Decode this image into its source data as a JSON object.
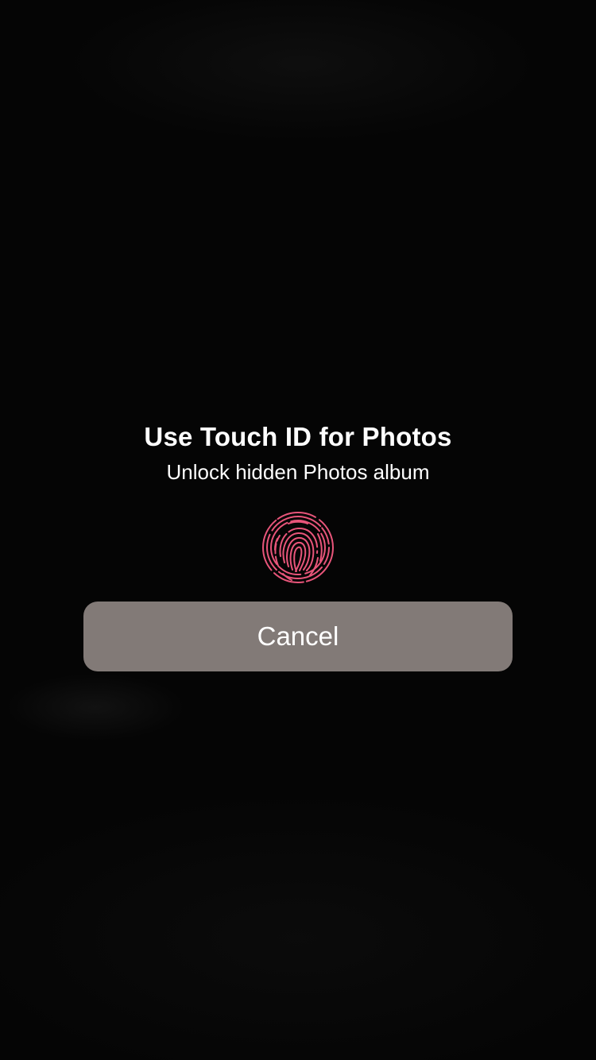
{
  "prompt": {
    "title": "Use Touch ID for Photos",
    "subtitle": "Unlock hidden Photos album",
    "icon": "fingerprint-icon",
    "icon_color": "#e8557a"
  },
  "actions": {
    "cancel_label": "Cancel",
    "cancel_color": "#827a77"
  }
}
